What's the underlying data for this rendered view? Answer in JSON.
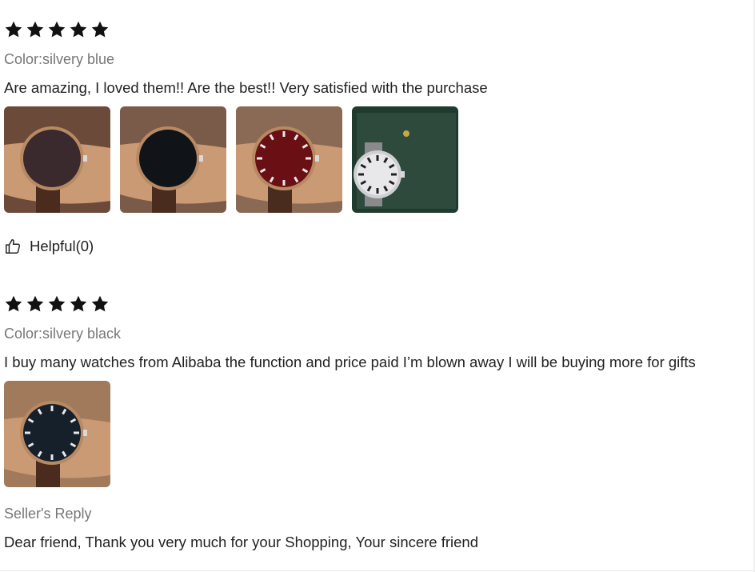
{
  "reviews": [
    {
      "rating": 5,
      "color_label": "Color:silvery blue",
      "text": "Are amazing, I loved them!! Are the best!! Very satisfied with the purchase",
      "photos": [
        {
          "icon": "watch-on-wrist-photo",
          "bg": "#6b4a3a",
          "dial": "#3a2a2e"
        },
        {
          "icon": "watch-app-menu-photo",
          "bg": "#7a5a48",
          "dial": "#101418"
        },
        {
          "icon": "watch-red-roman-dial-photo",
          "bg": "#8a6a55",
          "dial": "#6a1014"
        },
        {
          "icon": "watch-white-dial-box-photo",
          "bg": "#1f3a2e",
          "dial": "#e8e8ea"
        }
      ],
      "helpful_label": "Helpful(0)"
    },
    {
      "rating": 5,
      "color_label": "Color:silvery black",
      "text": "I buy many watches from Alibaba the function and price paid I’m blown away I will be buying more for gifts",
      "photos": [
        {
          "icon": "watch-black-roman-dial-photo",
          "bg": "#a07a5a",
          "dial": "#15202a"
        }
      ],
      "seller_reply_title": "Seller's Reply",
      "seller_reply_text": "Dear friend, Thank you very much for your Shopping, Your sincere friend"
    }
  ],
  "colors": {
    "star": "#111111",
    "muted_text": "#777777",
    "body_text": "#222222"
  }
}
